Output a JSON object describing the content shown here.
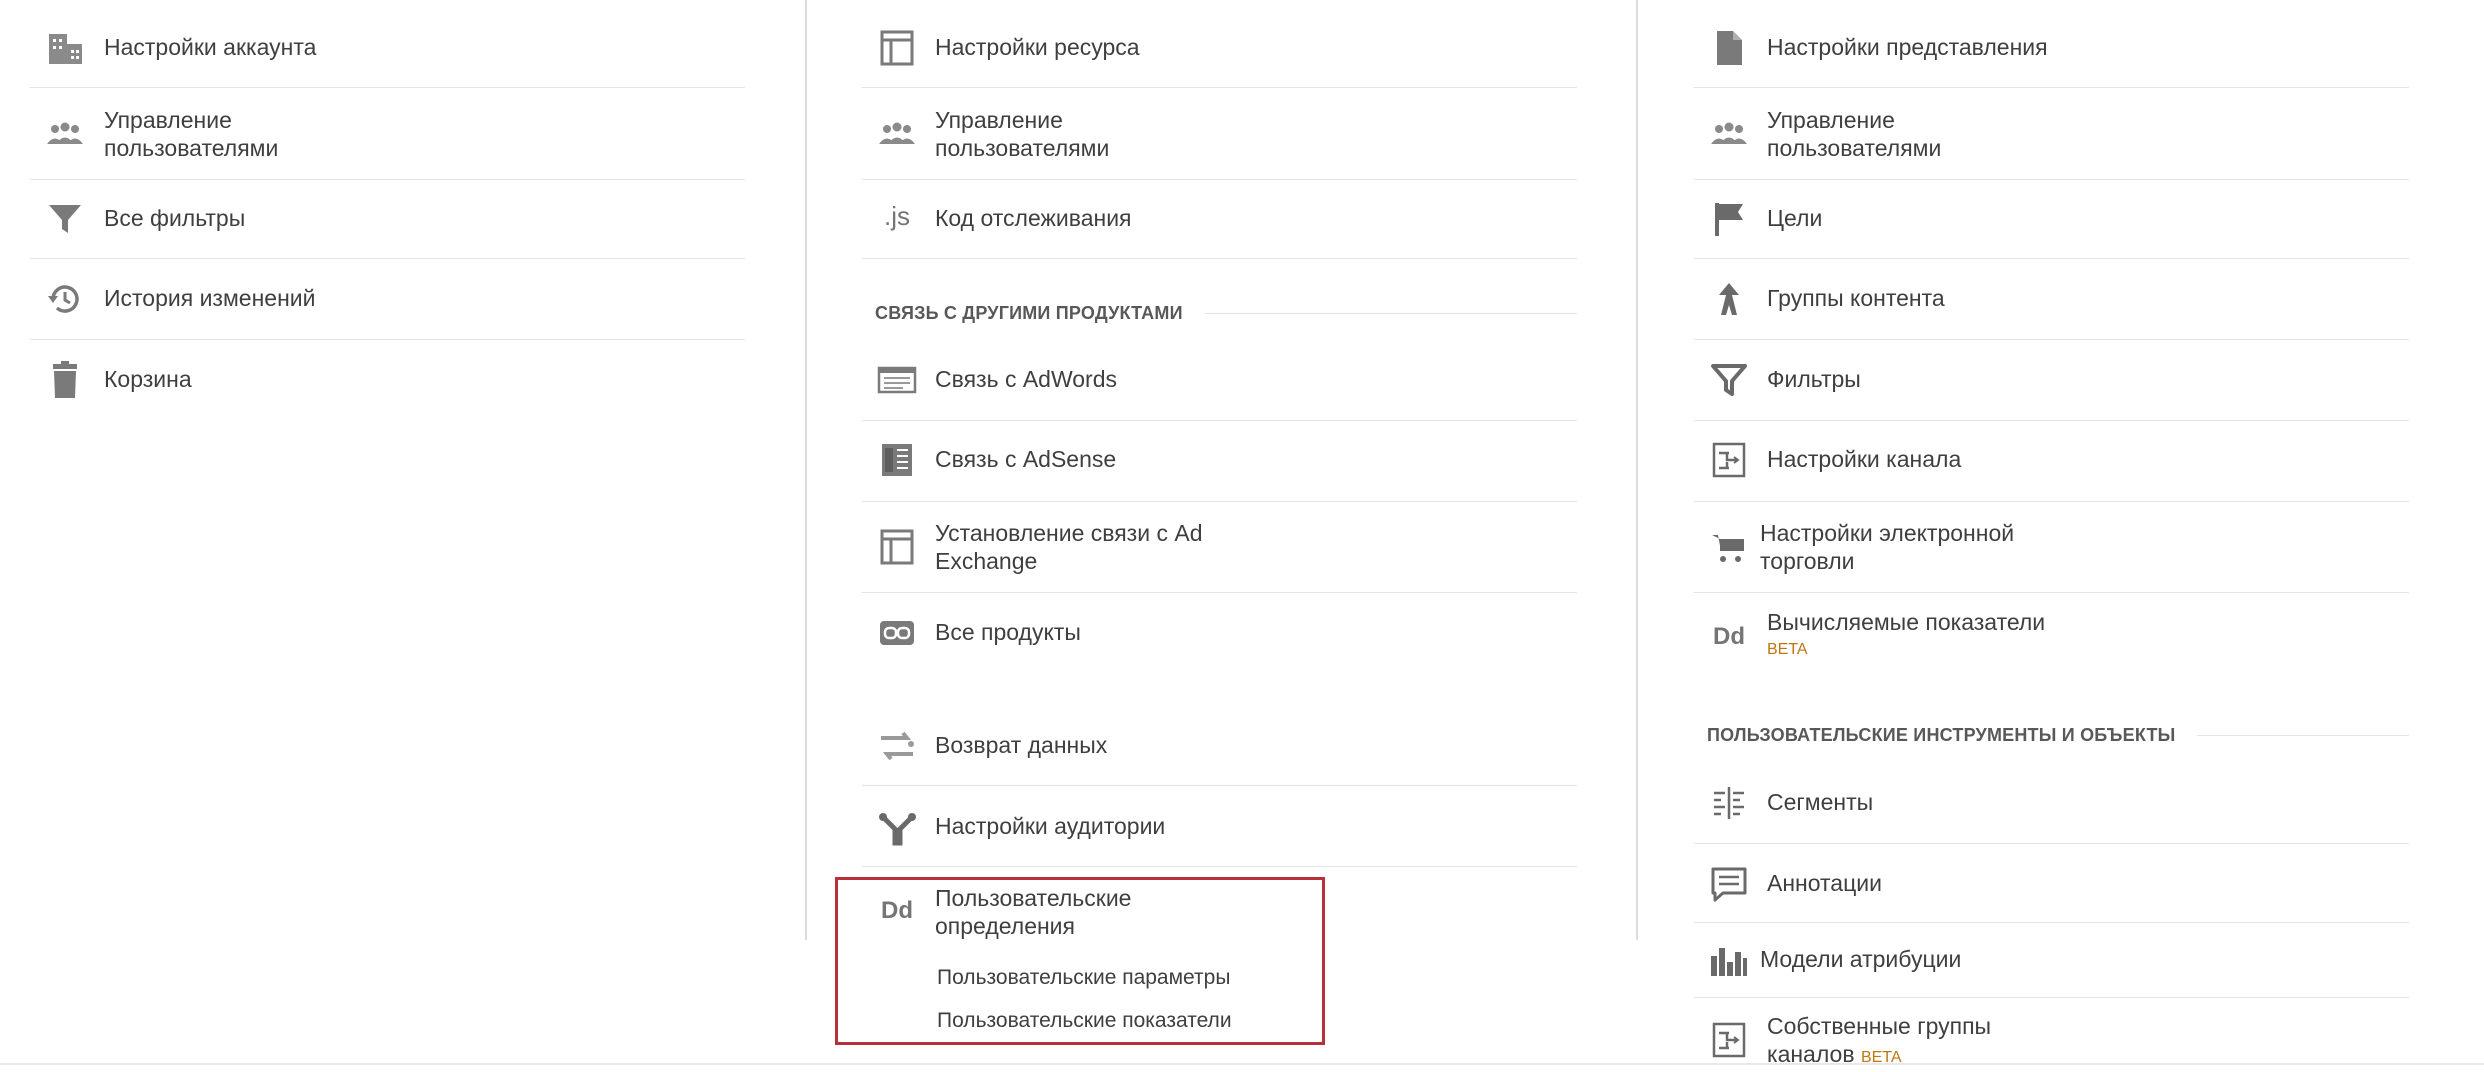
{
  "account": {
    "items": [
      {
        "icon": "building-icon",
        "label": "Настройки аккаунта"
      },
      {
        "icon": "users-icon",
        "label": "Управление пользователями"
      },
      {
        "icon": "filter-icon",
        "label": "Все фильтры"
      },
      {
        "icon": "history-icon",
        "label": "История изменений"
      },
      {
        "icon": "trash-icon",
        "label": "Корзина"
      }
    ]
  },
  "property": {
    "items": [
      {
        "icon": "property-settings-icon",
        "label": "Настройки ресурса"
      },
      {
        "icon": "users-icon",
        "label": "Управление пользователями"
      },
      {
        "icon": "js-icon",
        "label": "Код отслеживания",
        "glyph": ".js"
      }
    ],
    "linking_section": "СВЯЗЬ С ДРУГИМИ ПРОДУКТАМИ",
    "linking_items": [
      {
        "icon": "adwords-icon",
        "label": "Связь с AdWords"
      },
      {
        "icon": "adsense-icon",
        "label": "Связь с AdSense"
      },
      {
        "icon": "ad-exchange-icon",
        "label": "Установление связи с Ad Exchange"
      },
      {
        "icon": "link-icon",
        "label": "Все продукты"
      }
    ],
    "other_items": [
      {
        "icon": "data-import-icon",
        "label": "Возврат данных"
      },
      {
        "icon": "audience-icon",
        "label": "Настройки аудитории"
      }
    ],
    "custom_definitions": {
      "icon_glyph": "Dd",
      "label": "Пользовательские определения",
      "sub_items": [
        "Пользовательские параметры",
        "Пользовательские показатели"
      ]
    }
  },
  "view": {
    "items": [
      {
        "icon": "document-icon",
        "label": "Настройки представления"
      },
      {
        "icon": "users-icon",
        "label": "Управление пользователями"
      },
      {
        "icon": "flag-icon",
        "label": "Цели"
      },
      {
        "icon": "content-grouping-icon",
        "label": "Группы контента"
      },
      {
        "icon": "filter-icon",
        "label": "Фильтры"
      },
      {
        "icon": "channel-settings-icon",
        "label": "Настройки канала"
      },
      {
        "icon": "cart-icon",
        "label": "Настройки электронной торговли"
      },
      {
        "icon": "calculated-metrics-icon",
        "label": "Вычисляемые показатели",
        "glyph": "Dd",
        "badge": "BETA"
      }
    ],
    "tools_section": "ПОЛЬЗОВАТЕЛЬСКИЕ ИНСТРУМЕНТЫ И ОБЪЕКТЫ",
    "tools_items": [
      {
        "icon": "segments-icon",
        "label": "Сегменты"
      },
      {
        "icon": "annotations-icon",
        "label": "Аннотации"
      },
      {
        "icon": "attribution-models-icon",
        "label": "Модели атрибуции"
      },
      {
        "icon": "custom-channel-groupings-icon",
        "label": "Собственные группы каналов",
        "badge": "BETA"
      }
    ]
  }
}
